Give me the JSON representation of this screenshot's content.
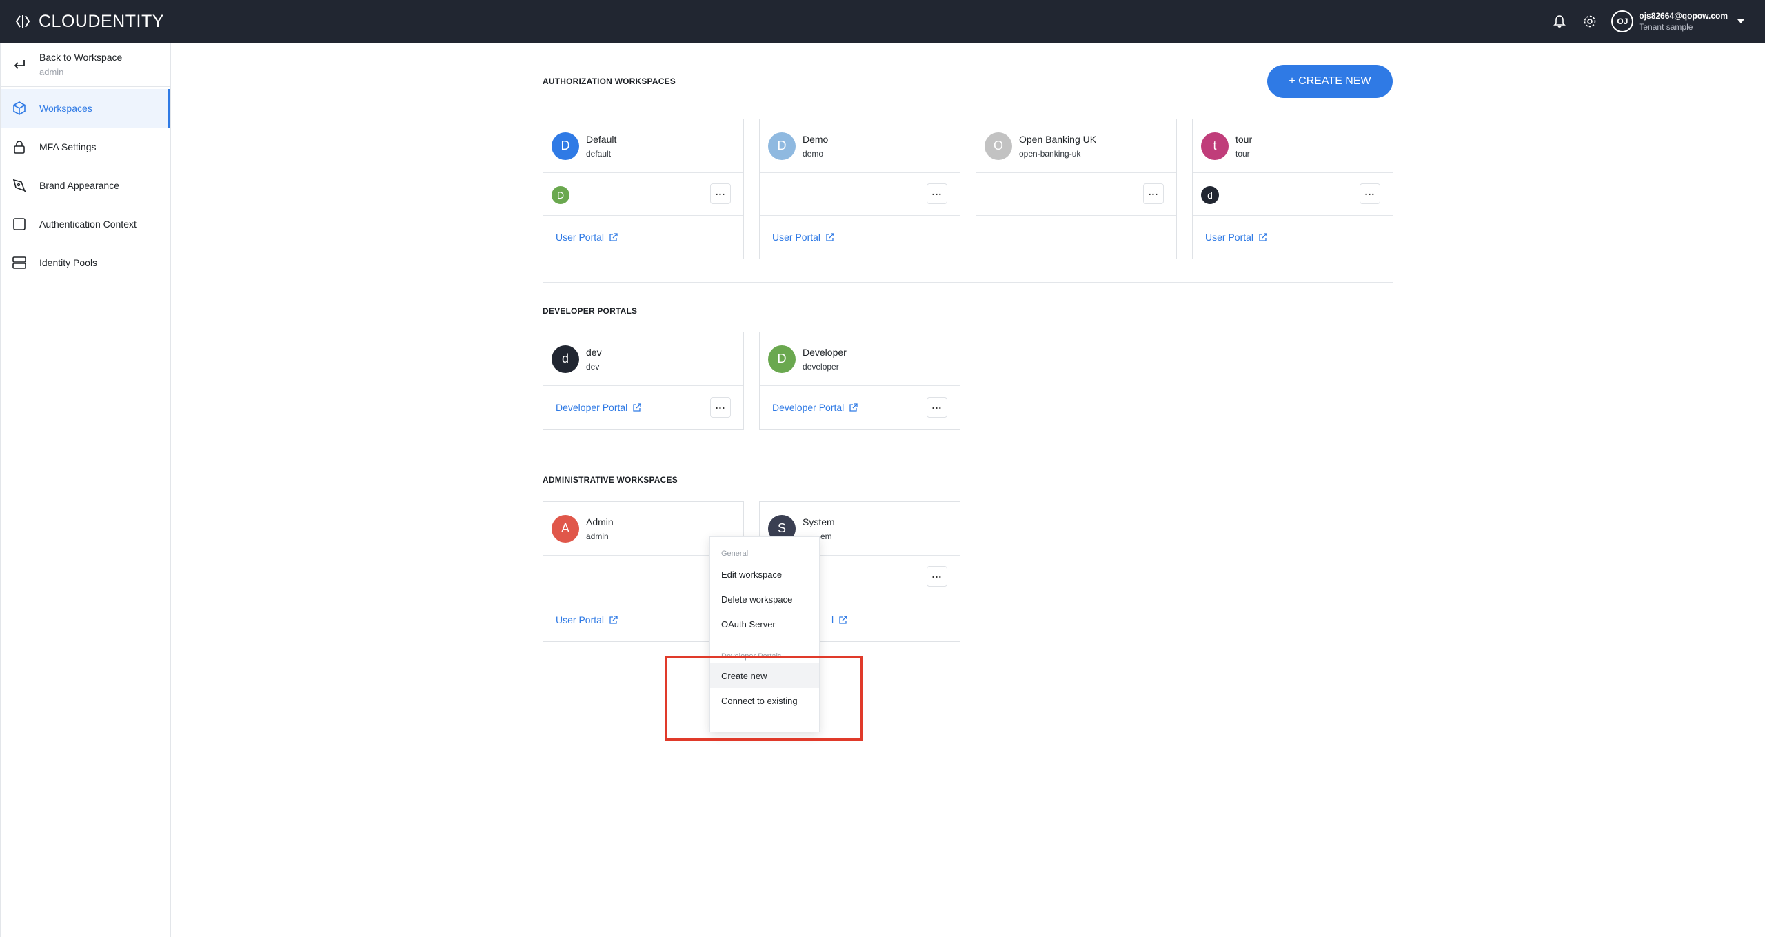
{
  "topbar": {
    "brand": "CLOUDENTITY",
    "user_initials": "OJ",
    "user_email": "ojs82664@qopow.com",
    "tenant": "Tenant sample"
  },
  "sidebar": {
    "back_label": "Back to Workspace",
    "back_sub": "admin",
    "items": [
      {
        "label": "Workspaces",
        "icon": "cube-icon",
        "active": true
      },
      {
        "label": "MFA Settings",
        "icon": "lock-icon"
      },
      {
        "label": "Brand Appearance",
        "icon": "pen-icon"
      },
      {
        "label": "Authentication Context",
        "icon": "square-icon"
      },
      {
        "label": "Identity Pools",
        "icon": "database-icon"
      }
    ]
  },
  "main": {
    "create_button": "+ CREATE NEW",
    "sections": {
      "authorization": "AUTHORIZATION WORKSPACES",
      "developer": "DEVELOPER PORTALS",
      "administrative": "ADMINISTRATIVE WORKSPACES"
    },
    "authorization_cards": [
      {
        "initial": "D",
        "name": "Default",
        "id": "default",
        "color": "#2f7ae5",
        "mini": "D",
        "mini_color": "#6aa84f",
        "link": "User Portal"
      },
      {
        "initial": "D",
        "name": "Demo",
        "id": "demo",
        "color": "#8fb9e0",
        "mini": "",
        "mini_color": "",
        "link": "User Portal"
      },
      {
        "initial": "O",
        "name": "Open Banking UK",
        "id": "open-banking-uk",
        "color": "#c2c2c2",
        "mini": "",
        "mini_color": "",
        "link": ""
      },
      {
        "initial": "t",
        "name": "tour",
        "id": "tour",
        "color": "#c03d7a",
        "mini": "d",
        "mini_color": "#212631",
        "link": "User Portal"
      }
    ],
    "developer_cards": [
      {
        "initial": "d",
        "name": "dev",
        "id": "dev",
        "color": "#212631",
        "link": "Developer Portal"
      },
      {
        "initial": "D",
        "name": "Developer",
        "id": "developer",
        "color": "#6aa84f",
        "link": "Developer Portal"
      }
    ],
    "admin_cards": [
      {
        "initial": "A",
        "name": "Admin",
        "id": "admin",
        "color": "#e0574a",
        "link": "User Portal"
      },
      {
        "initial": "S",
        "name": "System",
        "id": "system",
        "id_visible": "em",
        "color": "#3a3f52",
        "link": ""
      }
    ]
  },
  "menu": {
    "group_general": "General",
    "edit": "Edit workspace",
    "delete": "Delete workspace",
    "oauth": "OAuth Server",
    "group_dev": "Developer Portals",
    "create_new": "Create new",
    "connect": "Connect to existing"
  }
}
